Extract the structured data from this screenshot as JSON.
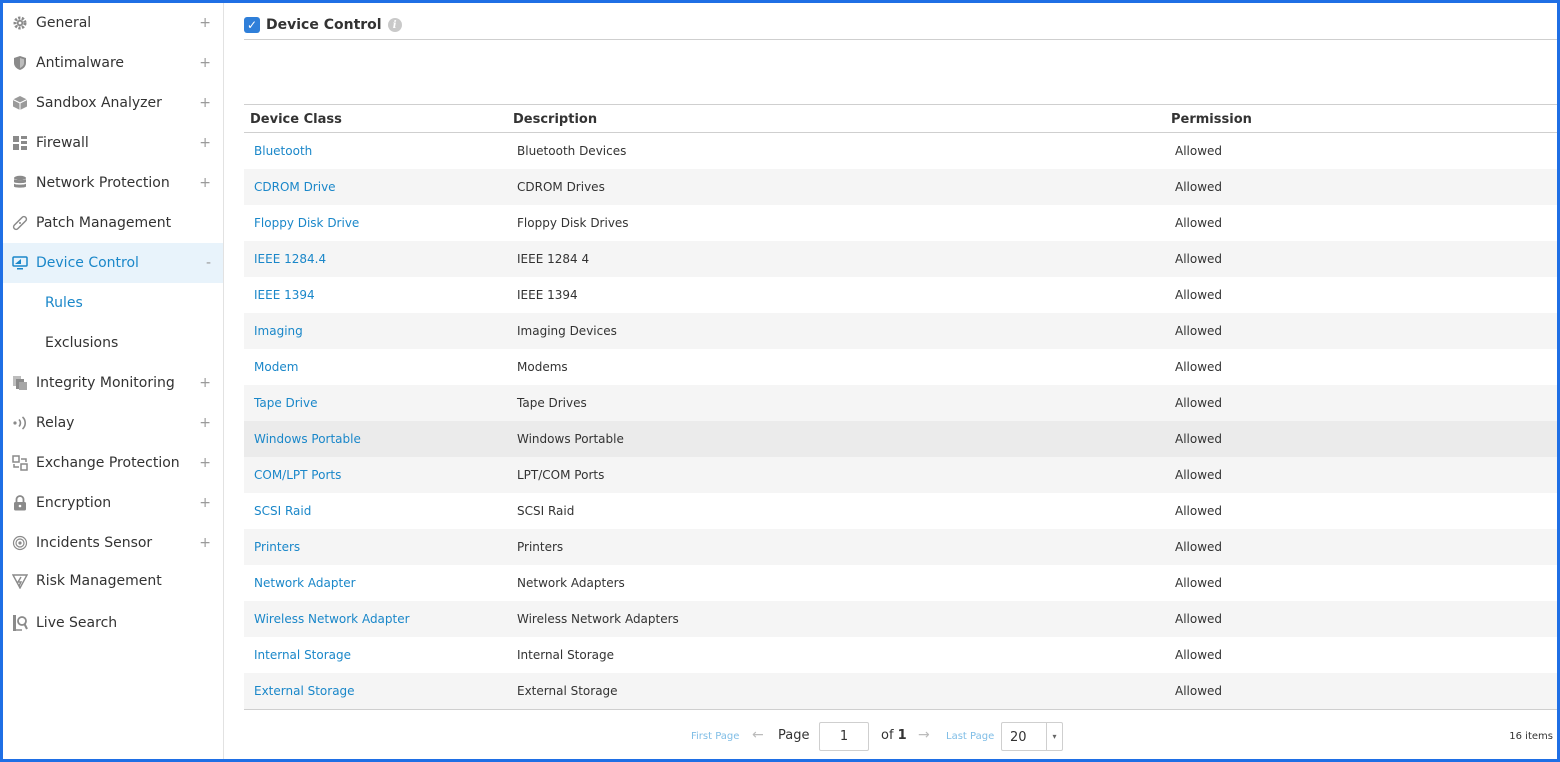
{
  "sidebar": {
    "items": [
      {
        "name": "general",
        "label": "General",
        "toggle": "+",
        "icon": "gear-icon"
      },
      {
        "name": "antimalware",
        "label": "Antimalware",
        "toggle": "+",
        "icon": "shield-icon"
      },
      {
        "name": "sandbox-analyzer",
        "label": "Sandbox Analyzer",
        "toggle": "+",
        "icon": "cube-icon"
      },
      {
        "name": "firewall",
        "label": "Firewall",
        "toggle": "+",
        "icon": "firewall-icon"
      },
      {
        "name": "network-protection",
        "label": "Network Protection",
        "toggle": "+",
        "icon": "database-icon"
      },
      {
        "name": "patch-management",
        "label": "Patch Management",
        "toggle": "",
        "icon": "bandage-icon"
      },
      {
        "name": "device-control",
        "label": "Device Control",
        "toggle": "-",
        "icon": "monitor-icon"
      },
      {
        "name": "rules",
        "label": "Rules"
      },
      {
        "name": "exclusions",
        "label": "Exclusions"
      },
      {
        "name": "integrity-monitoring",
        "label": "Integrity Monitoring",
        "toggle": "+",
        "icon": "files-icon"
      },
      {
        "name": "relay",
        "label": "Relay",
        "toggle": "+",
        "icon": "broadcast-icon"
      },
      {
        "name": "exchange-protection",
        "label": "Exchange Protection",
        "toggle": "+",
        "icon": "exchange-icon"
      },
      {
        "name": "encryption",
        "label": "Encryption",
        "toggle": "+",
        "icon": "lock-icon"
      },
      {
        "name": "incidents-sensor",
        "label": "Incidents Sensor",
        "toggle": "+",
        "icon": "at-sign-icon"
      },
      {
        "name": "risk-management",
        "label": "Risk Management",
        "toggle": "",
        "icon": "risk-icon"
      },
      {
        "name": "live-search",
        "label": "Live Search",
        "toggle": "",
        "icon": "search-document-icon"
      }
    ]
  },
  "section": {
    "title": "Device Control",
    "info_glyph": "i"
  },
  "table": {
    "columns": [
      "Device Class",
      "Description",
      "Permission"
    ],
    "rows": [
      {
        "device_class": "Bluetooth",
        "description": "Bluetooth Devices",
        "permission": "Allowed"
      },
      {
        "device_class": "CDROM Drive",
        "description": "CDROM Drives",
        "permission": "Allowed"
      },
      {
        "device_class": "Floppy Disk Drive",
        "description": "Floppy Disk Drives",
        "permission": "Allowed"
      },
      {
        "device_class": "IEEE 1284.4",
        "description": "IEEE 1284 4",
        "permission": "Allowed"
      },
      {
        "device_class": "IEEE 1394",
        "description": "IEEE 1394",
        "permission": "Allowed"
      },
      {
        "device_class": "Imaging",
        "description": "Imaging Devices",
        "permission": "Allowed"
      },
      {
        "device_class": "Modem",
        "description": "Modems",
        "permission": "Allowed"
      },
      {
        "device_class": "Tape Drive",
        "description": "Tape Drives",
        "permission": "Allowed"
      },
      {
        "device_class": "Windows Portable",
        "description": "Windows Portable",
        "permission": "Allowed"
      },
      {
        "device_class": "COM/LPT Ports",
        "description": "LPT/COM Ports",
        "permission": "Allowed"
      },
      {
        "device_class": "SCSI Raid",
        "description": "SCSI Raid",
        "permission": "Allowed"
      },
      {
        "device_class": "Printers",
        "description": "Printers",
        "permission": "Allowed"
      },
      {
        "device_class": "Network Adapter",
        "description": "Network Adapters",
        "permission": "Allowed"
      },
      {
        "device_class": "Wireless Network Adapter",
        "description": "Wireless Network Adapters",
        "permission": "Allowed"
      },
      {
        "device_class": "Internal Storage",
        "description": "Internal Storage",
        "permission": "Allowed"
      },
      {
        "device_class": "External Storage",
        "description": "External Storage",
        "permission": "Allowed"
      }
    ]
  },
  "pagination": {
    "first_page": "First Page",
    "prev_arrow": "←",
    "page_label": "Page",
    "current_page": "1",
    "of_label": "of",
    "total_pages": "1",
    "next_arrow": "→",
    "last_page": "Last Page",
    "page_size": "20",
    "dropdown_glyph": "▾",
    "item_count": "16 items"
  },
  "colors": {
    "accent": "#1a87c9",
    "frame": "#1f6fe5",
    "active_bg": "#e8f3fb"
  }
}
